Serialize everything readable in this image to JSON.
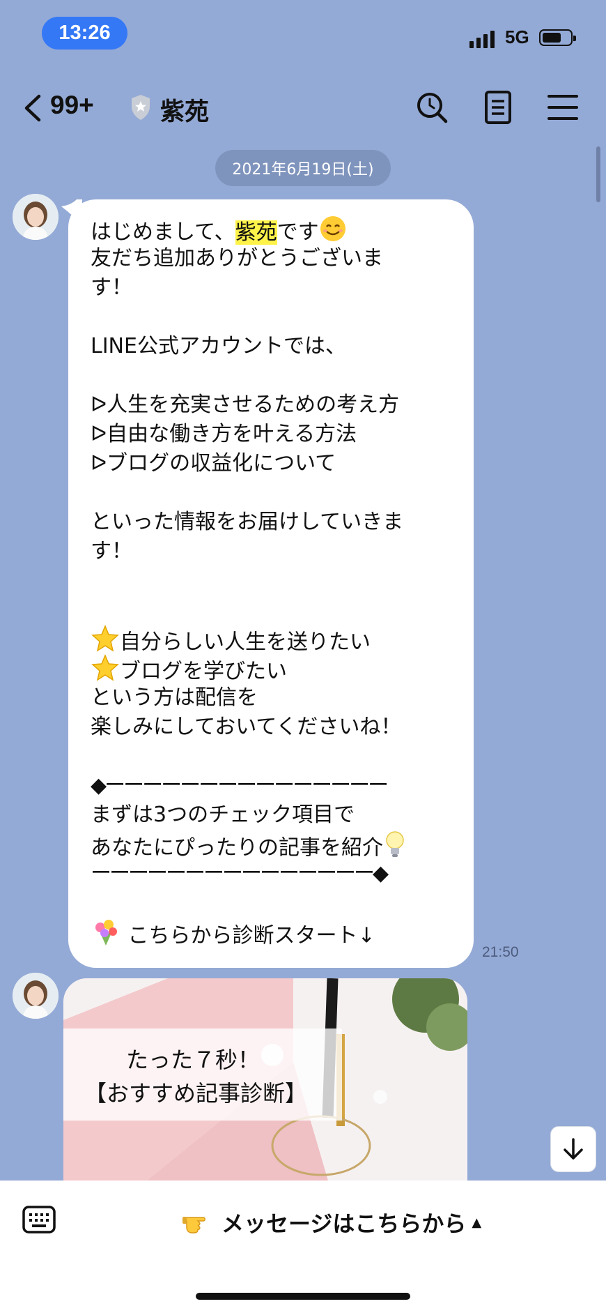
{
  "status_bar": {
    "time": "13:26",
    "network": "5G"
  },
  "header": {
    "unread_count": "99+",
    "chat_name": "紫苑"
  },
  "date_separator": "2021年6月19日(土)",
  "message": {
    "time": "21:50",
    "intro_before": "はじめまして、",
    "intro_name": "紫苑",
    "intro_after": "です",
    "line2": "友だち追加ありがとうございま",
    "line3": "す！",
    "line5": "LINE公式アカウントでは、",
    "bullet1": "ᐅ人生を充実させるための考え方",
    "bullet2": "ᐅ自由な働き方を叶える方法",
    "bullet3": "ᐅブログの収益化について",
    "line10": "といった情報をお届けしていきま",
    "line11": "す！",
    "star1": "自分らしい人生を送りたい",
    "star2": "ブログを学びたい",
    "line16": "という方は配信を",
    "line17": "楽しみにしておいてくださいね！",
    "divider_top": "◆ーーーーーーーーーーーーーーー",
    "line20": "まずは3つのチェック項目で",
    "line21": "あなたにぴったりの記事を紹介",
    "divider_bottom": "ーーーーーーーーーーーーーーー◆",
    "cta": "こちらから診断スタート↓"
  },
  "card": {
    "title_line1": "たった７秒！",
    "title_line2": "【おすすめ記事診断】"
  },
  "rich_menu": {
    "label": "メッセージはこちらから",
    "arrow": "▲"
  }
}
